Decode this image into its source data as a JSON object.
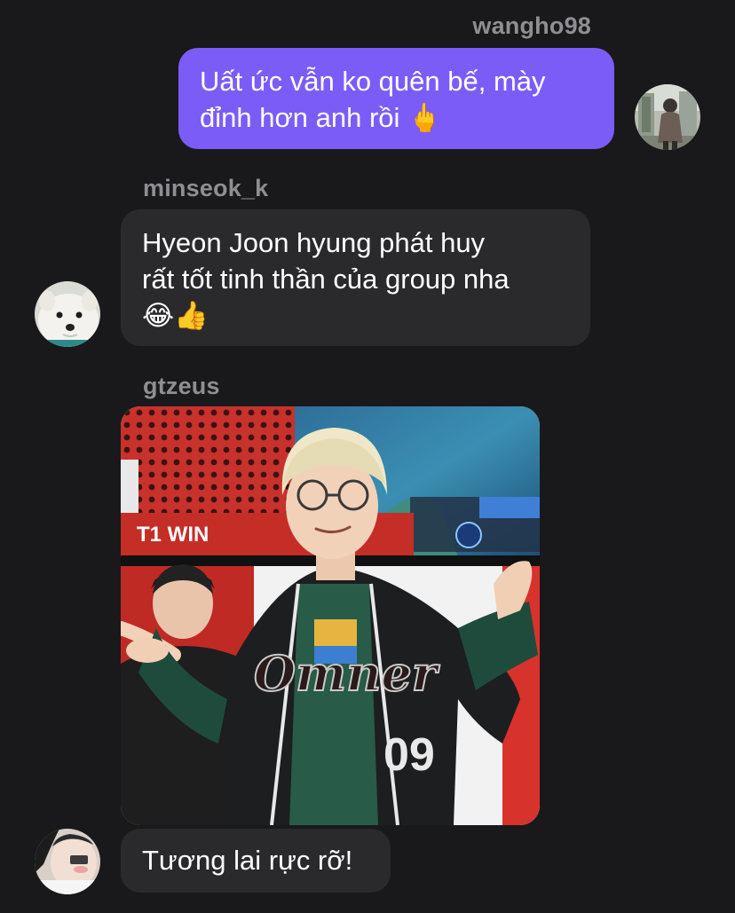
{
  "messages": [
    {
      "sender": "wangho98",
      "direction": "outgoing",
      "lines": [
        "Uất ức vẫn ko quên bế, mày",
        "đỉnh hơn anh rồi 🖕"
      ],
      "avatar_icon": "person-standing-avatar"
    },
    {
      "sender": "minseok_k",
      "direction": "incoming",
      "lines": [
        "Hyeon Joon hyung phát huy",
        "rất tốt tinh thần của group nha",
        "😂👍"
      ],
      "avatar_icon": "white-dog-avatar"
    },
    {
      "sender": "gtzeus",
      "direction": "incoming",
      "photo": {
        "banner_text": "T1 WIN",
        "jersey_text": "Omner",
        "jersey_number": "09"
      },
      "lines": [
        "Tương lai rực rỡ!"
      ],
      "avatar_icon": "person-selfie-avatar"
    }
  ],
  "colors": {
    "background": "#19191b",
    "outgoing_bubble": "#7c5cf7",
    "incoming_bubble": "#2a2a2d",
    "sender_name": "#8e8e93",
    "text": "#ffffff"
  }
}
